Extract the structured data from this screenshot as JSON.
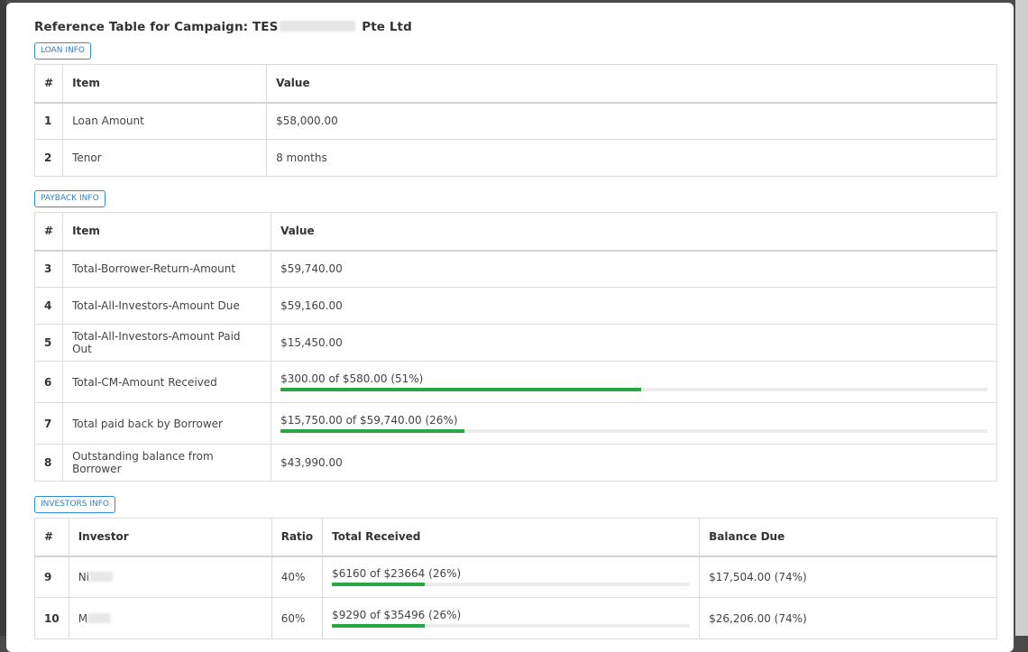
{
  "title_prefix": "Reference Table for Campaign: TES",
  "title_suffix": "Pte Ltd",
  "loan": {
    "label": "LOAN INFO",
    "headers": [
      "#",
      "Item",
      "Value"
    ],
    "rows": [
      {
        "n": "1",
        "item": "Loan Amount",
        "value": "$58,000.00"
      },
      {
        "n": "2",
        "item": "Tenor",
        "value": "8 months"
      }
    ]
  },
  "payback": {
    "label": "PAYBACK INFO",
    "headers": [
      "#",
      "Item",
      "Value"
    ],
    "rows": [
      {
        "n": "3",
        "item": "Total-Borrower-Return-Amount",
        "value": "$59,740.00"
      },
      {
        "n": "4",
        "item": "Total-All-Investors-Amount Due",
        "value": "$59,160.00"
      },
      {
        "n": "5",
        "item": "Total-All-Investors-Amount Paid Out",
        "value": "$15,450.00"
      },
      {
        "n": "6",
        "item": "Total-CM-Amount Received",
        "value": "$300.00 of $580.00 (51%)",
        "progress": 0.51
      },
      {
        "n": "7",
        "item": "Total paid back by Borrower",
        "value": "$15,750.00 of $59,740.00 (26%)",
        "progress": 0.26
      },
      {
        "n": "8",
        "item": "Outstanding balance from Borrower",
        "value": "$43,990.00"
      }
    ]
  },
  "investors": {
    "label": "INVESTORS INFO",
    "headers": [
      "#",
      "Investor",
      "Ratio",
      "Total Received",
      "Balance Due"
    ],
    "rows": [
      {
        "n": "9",
        "name": "Ni",
        "ratio": "40%",
        "received": "$6160 of $23664 (26%)",
        "progress": 0.26,
        "balance": "$17,504.00 (74%)"
      },
      {
        "n": "10",
        "name": "M",
        "ratio": "60%",
        "received": "$9290 of $35496 (26%)",
        "progress": 0.26,
        "balance": "$26,206.00 (74%)"
      }
    ]
  },
  "colors": {
    "progress": "#28a745",
    "button_border": "#2f8ddb"
  }
}
